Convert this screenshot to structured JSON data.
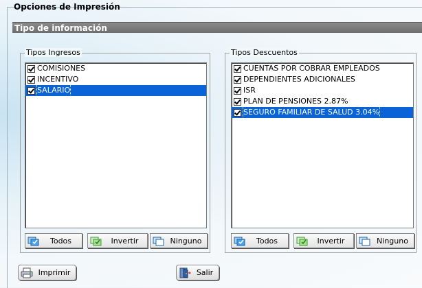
{
  "panel": {
    "title": "Opciones de Impresión"
  },
  "section": {
    "title": "Tipo de información"
  },
  "ingresos": {
    "legend": "Tipos Ingresos",
    "items": [
      {
        "label": "COMISIONES",
        "checked": true,
        "selected": false
      },
      {
        "label": "INCENTIVO",
        "checked": true,
        "selected": false
      },
      {
        "label": "SALARIO",
        "checked": true,
        "selected": true
      }
    ],
    "buttons": {
      "todos": "Todos",
      "invertir": "Invertir",
      "ninguno": "Ninguno"
    }
  },
  "descuentos": {
    "legend": "Tipos Descuentos",
    "items": [
      {
        "label": "CUENTAS POR COBRAR EMPLEADOS",
        "checked": true,
        "selected": false
      },
      {
        "label": "DEPENDIENTES ADICIONALES",
        "checked": true,
        "selected": false
      },
      {
        "label": "ISR",
        "checked": true,
        "selected": false
      },
      {
        "label": "PLAN DE PENSIONES 2.87%",
        "checked": true,
        "selected": false
      },
      {
        "label": "SEGURO FAMILIAR DE SALUD 3.04%",
        "checked": true,
        "selected": true
      }
    ],
    "buttons": {
      "todos": "Todos",
      "invertir": "Invertir",
      "ninguno": "Ninguno"
    }
  },
  "actions": {
    "imprimir": "Imprimir",
    "salir": "Salir"
  },
  "colors": {
    "selection": "#0a64d8",
    "title_bar": "#7a7a7a"
  }
}
